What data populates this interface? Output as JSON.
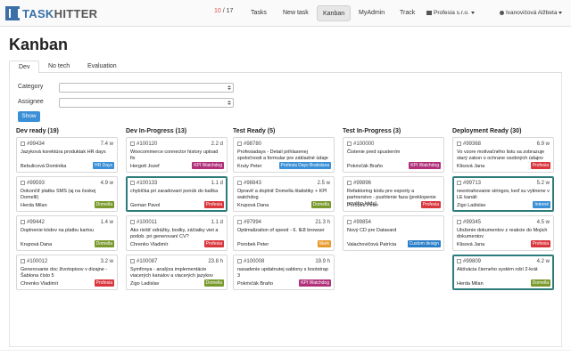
{
  "app": {
    "logo_a": "TASK",
    "logo_b": "HITTER",
    "counter_current": "10",
    "counter_sep": " / ",
    "counter_total": "17"
  },
  "nav": {
    "items": [
      "Tasks",
      "New task",
      "Kanban",
      "MyAdmin",
      "Track"
    ],
    "active": "Kanban",
    "company": "Profesia s.r.o.",
    "user": "Ivanovičová Alžbeta"
  },
  "page": {
    "title": "Kanban",
    "tabs": [
      "Dev",
      "No tech",
      "Evaluation"
    ]
  },
  "filters": {
    "category_label": "Category",
    "assignee_label": "Assignee",
    "show_label": "Show"
  },
  "colors": {
    "accent": "#3a8fd6",
    "selected_border": "#2e7b7b",
    "tag_profesia": "#d9363e",
    "tag_dornella": "#7a9a2e",
    "tag_kpi": "#b0307a",
    "tag_hrdays": "#3a8fd6",
    "tag_internal": "#3a8fd6",
    "tag_custom": "#2a7fc8",
    "tag_mark": "#e89a2c"
  },
  "columns": [
    {
      "title": "Dev ready (19)",
      "cards": [
        {
          "id": "#99434",
          "est": "7.4 w",
          "text": "Jazyková korektúra produktak HR days",
          "user": "Bebulicová Dominika",
          "tag": "HR Days",
          "tag_color": "#3a8fd6",
          "selected": false
        },
        {
          "id": "#99593",
          "est": "4.9 w",
          "text": "Dokončiť platbu SMS (aj na českej Domelli)",
          "user": "Herda Milan",
          "tag": "Domella",
          "tag_color": "#7a9a2e",
          "selected": false
        },
        {
          "id": "#99442",
          "est": "1.4 w",
          "text": "Doplnenie kódov na platbu kartou",
          "user": "Krupová Dana",
          "tag": "Domella",
          "tag_color": "#7a9a2e",
          "selected": false
        },
        {
          "id": "#100012",
          "est": "3.2 w",
          "text": "Generovanie doc životopisov v dizajne - Šablona číslo 5",
          "user": "Chrenko Vladimír",
          "tag": "Profesia",
          "tag_color": "#d9363e",
          "selected": false
        }
      ]
    },
    {
      "title": "Dev In-Progress (13)",
      "cards": [
        {
          "id": "#100120",
          "est": "2.2 d",
          "text": "Woocommerce connector history upload fix",
          "user": "Hergott Jozef",
          "tag": "KPI Watchdog",
          "tag_color": "#b0307a",
          "selected": false
        },
        {
          "id": "#100133",
          "est": "1.1 d",
          "text": "chybička pri zaradovaní ponúk do balíka",
          "user": "Geman Pavol",
          "tag": "Profesia",
          "tag_color": "#d9363e",
          "selected": true
        },
        {
          "id": "#100011",
          "est": "1.1 d",
          "text": "Ako riešiť odrážky, bodky, záčiatky viet a podob. pri generovaní CV?",
          "user": "Chrenko Vladimír",
          "tag": "Profesia",
          "tag_color": "#d9363e",
          "selected": false
        },
        {
          "id": "#100087",
          "est": "23.8 h",
          "text": "Symfonya - analýza implementácie viacerých kanalov a viacerých jazykov",
          "user": "Zigo Ladislav",
          "tag": "Domella",
          "tag_color": "#7a9a2e",
          "selected": false
        }
      ]
    },
    {
      "title": "Test Ready (5)",
      "cards": [
        {
          "id": "#98780",
          "est": "",
          "text": "Profesiadays - Detail prihlasenej spoločnosti a formular pre základné údaje",
          "user": "Kruty Peter",
          "tag": "Profesia Days Bratislava",
          "tag_color": "#3a8fd6",
          "selected": false
        },
        {
          "id": "#98843",
          "est": "2.5 w",
          "text": "Opraviť a doplniť Domella štatistiky + KPI watchdog",
          "user": "Krupová Dana",
          "tag": "Domella",
          "tag_color": "#7a9a2e",
          "selected": false
        },
        {
          "id": "#97994",
          "est": "21.3 h",
          "text": "Optimalization of speed - 6. IE8 browser",
          "user": "Porobek Peter",
          "tag": "Mark",
          "tag_color": "#e89a2c",
          "selected": false
        },
        {
          "id": "#100008",
          "est": "19.9 h",
          "text": "nasadenie updatnutej sablony s bootstrap 3",
          "user": "Pokrivčák Braňo",
          "tag": "KPI Watchdog",
          "tag_color": "#b0307a",
          "selected": false
        }
      ]
    },
    {
      "title": "Test In-Progress (3)",
      "cards": [
        {
          "id": "#100000",
          "est": "",
          "text": "Čistenie pred spustením",
          "user": "Pokrivčák Braňo",
          "tag": "KPI Watchdog",
          "tag_color": "#b0307a",
          "selected": false
        },
        {
          "id": "#99896",
          "est": "",
          "text": "Refaktoring kódu pre exporty a partnerstvo - pushlenie faza (preklopenie nového kódu)",
          "user": "Porobek Peter",
          "tag": "Profesia",
          "tag_color": "#d9363e",
          "selected": false
        },
        {
          "id": "#99854",
          "est": "",
          "text": "Nový CD pre Datavard",
          "user": "Valachovičová Patrícia",
          "tag": "Custom design",
          "tag_color": "#2a7fc8",
          "selected": false
        }
      ]
    },
    {
      "title": "Deployment Ready (30)",
      "cards": [
        {
          "id": "#99368",
          "est": "6.9 w",
          "text": "Vo vzore motivačného listu sa zobrazuje starý zakon o ochrane osobných údajov",
          "user": "Klisová Jana",
          "tag": "Profesia",
          "tag_color": "#d9363e",
          "selected": false
        },
        {
          "id": "#99713",
          "est": "5.2 w",
          "text": "neextrahovanie stringov, keď su vytinene v LE kanáli",
          "user": "Zigo Ladislav",
          "tag": "Interné",
          "tag_color": "#3a8fd6",
          "selected": true
        },
        {
          "id": "#99345",
          "est": "4.5 w",
          "text": "Uloženie dokumentov z reakcie do Mojich dokumentov",
          "user": "Klisová Jana",
          "tag": "Profesia",
          "tag_color": "#d9363e",
          "selected": false
        },
        {
          "id": "#99809",
          "est": "4.2 w",
          "text": "Aktívácia čierneho systém robí 2-krát",
          "user": "Herda Milan",
          "tag": "Domella",
          "tag_color": "#7a9a2e",
          "selected": true
        }
      ]
    }
  ]
}
